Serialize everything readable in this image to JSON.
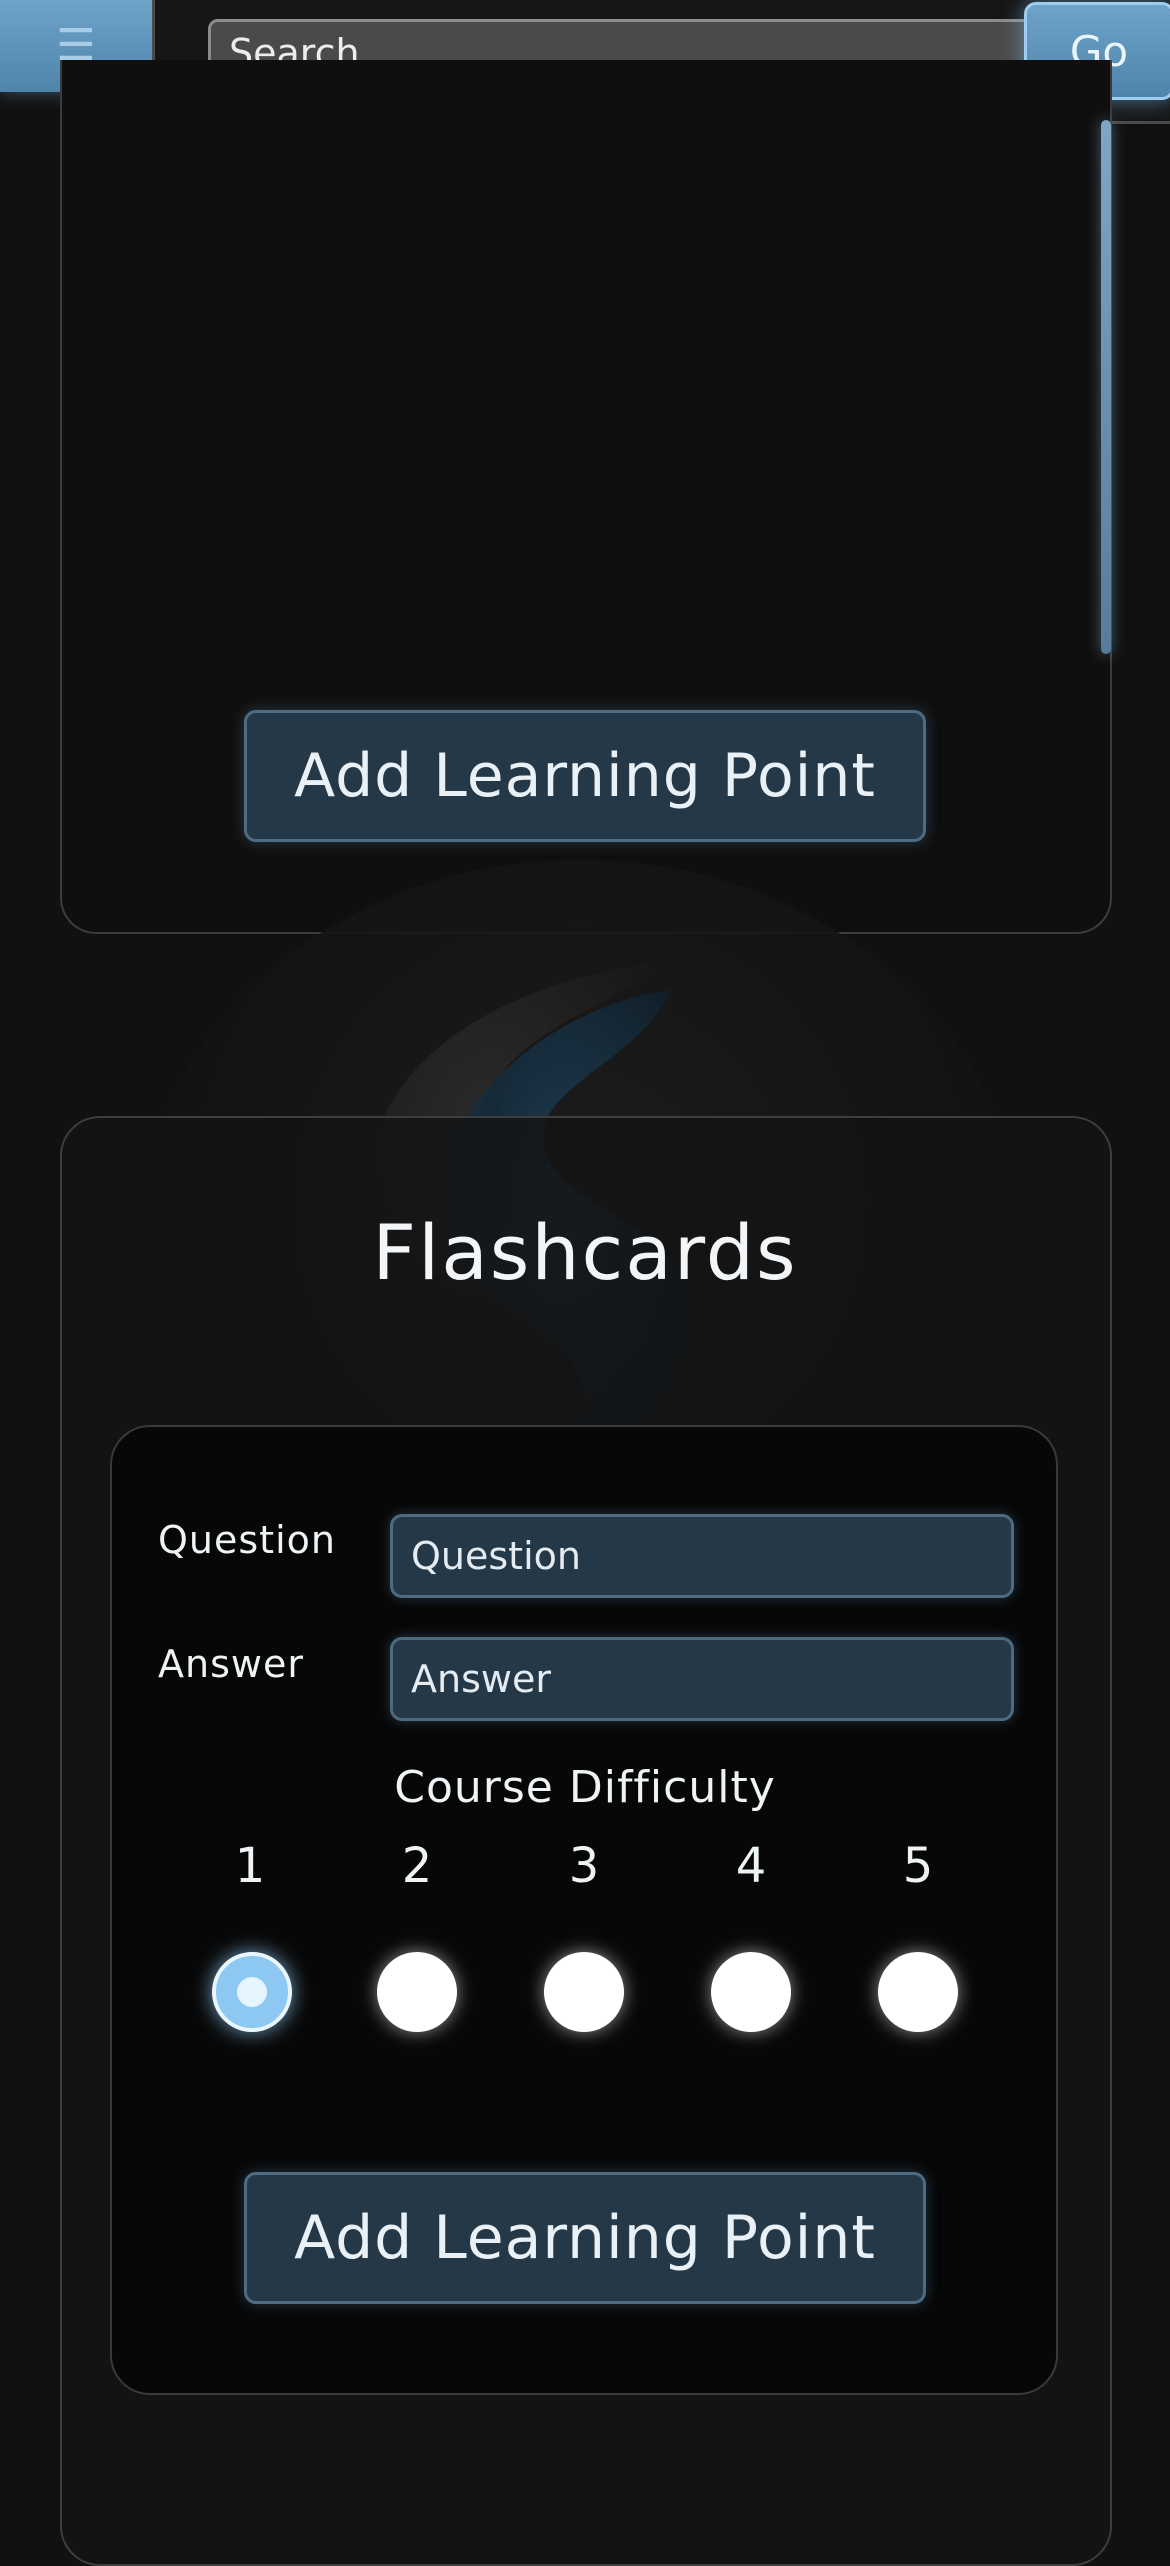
{
  "header": {
    "menu_icon": "hamburger-icon",
    "menu_glyph": "☰",
    "search_placeholder": "Search...",
    "go_label": "Go"
  },
  "learning_panel": {
    "add_button_label": "Add Learning Point"
  },
  "flashcards": {
    "title": "Flashcards",
    "question_label": "Question",
    "question_placeholder": "Question",
    "answer_label": "Answer",
    "answer_placeholder": "Answer",
    "difficulty_title": "Course Difficulty",
    "difficulty_options": [
      "1",
      "2",
      "3",
      "4",
      "5"
    ],
    "selected_difficulty": "1",
    "add_button_label": "Add Learning Point"
  },
  "colors": {
    "accent": "#6fa3c8",
    "button_bg": "#243847",
    "background": "#111111"
  }
}
